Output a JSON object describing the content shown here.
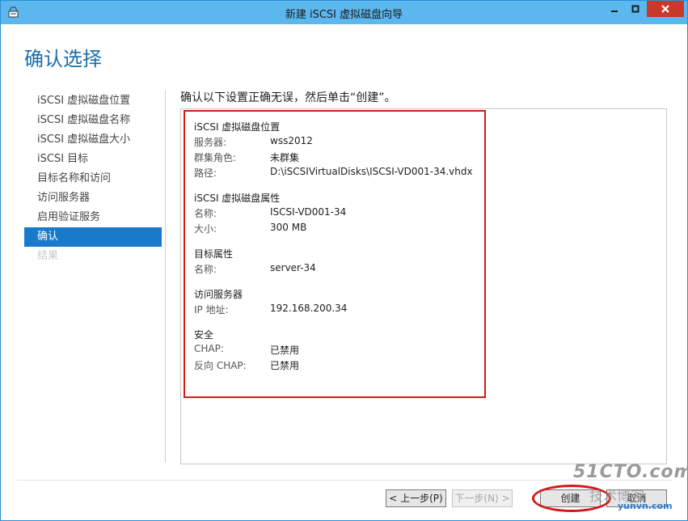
{
  "window": {
    "title": "新建 iSCSI 虚拟磁盘向导",
    "minimize_glyph": "—",
    "maximize_glyph": "□",
    "close_glyph": "✕"
  },
  "page": {
    "header": "确认选择",
    "instruction": "确认以下设置正确无误，然后单击“创建”。"
  },
  "sidebar": {
    "items": [
      {
        "label": "iSCSI 虚拟磁盘位置",
        "state": "normal"
      },
      {
        "label": "iSCSI 虚拟磁盘名称",
        "state": "normal"
      },
      {
        "label": "iSCSI 虚拟磁盘大小",
        "state": "normal"
      },
      {
        "label": "iSCSI 目标",
        "state": "normal"
      },
      {
        "label": "目标名称和访问",
        "state": "normal"
      },
      {
        "label": "访问服务器",
        "state": "normal"
      },
      {
        "label": "启用验证服务",
        "state": "normal"
      },
      {
        "label": "确认",
        "state": "active"
      },
      {
        "label": "结果",
        "state": "disabled"
      }
    ]
  },
  "summary": {
    "location": {
      "title": "iSCSI 虚拟磁盘位置",
      "rows": [
        {
          "label": "服务器:",
          "value": "wss2012"
        },
        {
          "label": "群集角色:",
          "value": "未群集"
        },
        {
          "label": "路径:",
          "value": "D:\\iSCSIVirtualDisks\\ISCSI-VD001-34.vhdx"
        }
      ]
    },
    "properties": {
      "title": "iSCSI 虚拟磁盘属性",
      "rows": [
        {
          "label": "名称:",
          "value": "ISCSI-VD001-34"
        },
        {
          "label": "大小:",
          "value": "300 MB"
        }
      ]
    },
    "target": {
      "title": "目标属性",
      "rows": [
        {
          "label": "名称:",
          "value": "server-34"
        }
      ]
    },
    "access": {
      "title": "访问服务器",
      "rows": [
        {
          "label": "IP 地址:",
          "value": "192.168.200.34"
        }
      ]
    },
    "security": {
      "title": "安全",
      "rows": [
        {
          "label": "CHAP:",
          "value": "已禁用"
        },
        {
          "label": "反向 CHAP:",
          "value": "已禁用"
        }
      ]
    }
  },
  "buttons": {
    "prev": "< 上一步(P)",
    "next": "下一步(N) >",
    "create": "创建",
    "cancel": "取消"
  },
  "watermark": {
    "main": "51CTO.com",
    "sub": "技术博客",
    "url": "yunvn.com"
  },
  "colors": {
    "titlebar": "#5bb7ee",
    "accent": "#1979ca",
    "highlight": "#d41a1a",
    "close": "#c7392b"
  }
}
